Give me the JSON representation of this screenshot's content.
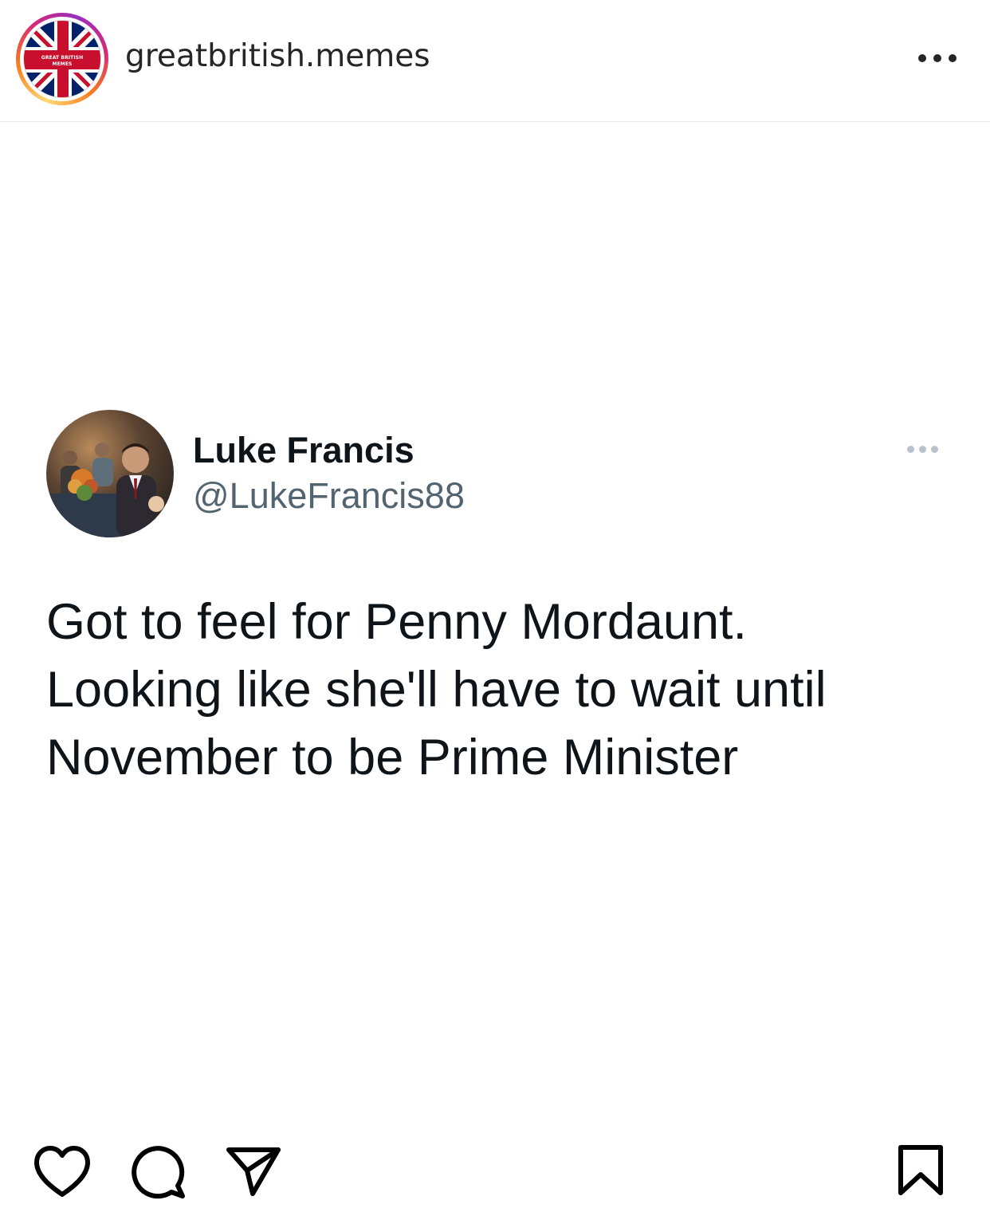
{
  "post_header": {
    "account_name": "greatbritish.memes",
    "avatar_text_line1": "GREAT BRITISH",
    "avatar_text_line2": "MEMES",
    "more_icon": "more-horizontal-icon"
  },
  "tweet": {
    "display_name": "Luke Francis",
    "handle": "@LukeFrancis88",
    "more_icon": "more-horizontal-icon",
    "text_lines": [
      "Got to feel for Penny Mordaunt.",
      "Looking like she'll have to wait until",
      "November to be Prime Minister"
    ]
  },
  "actions": {
    "like_icon": "heart-icon",
    "comment_icon": "comment-icon",
    "share_icon": "send-icon",
    "save_icon": "bookmark-icon"
  },
  "colors": {
    "text_primary": "#262626",
    "tweet_text": "#0f1419",
    "tweet_handle": "#536471",
    "flag_red": "#c8102e",
    "flag_blue": "#012169"
  }
}
